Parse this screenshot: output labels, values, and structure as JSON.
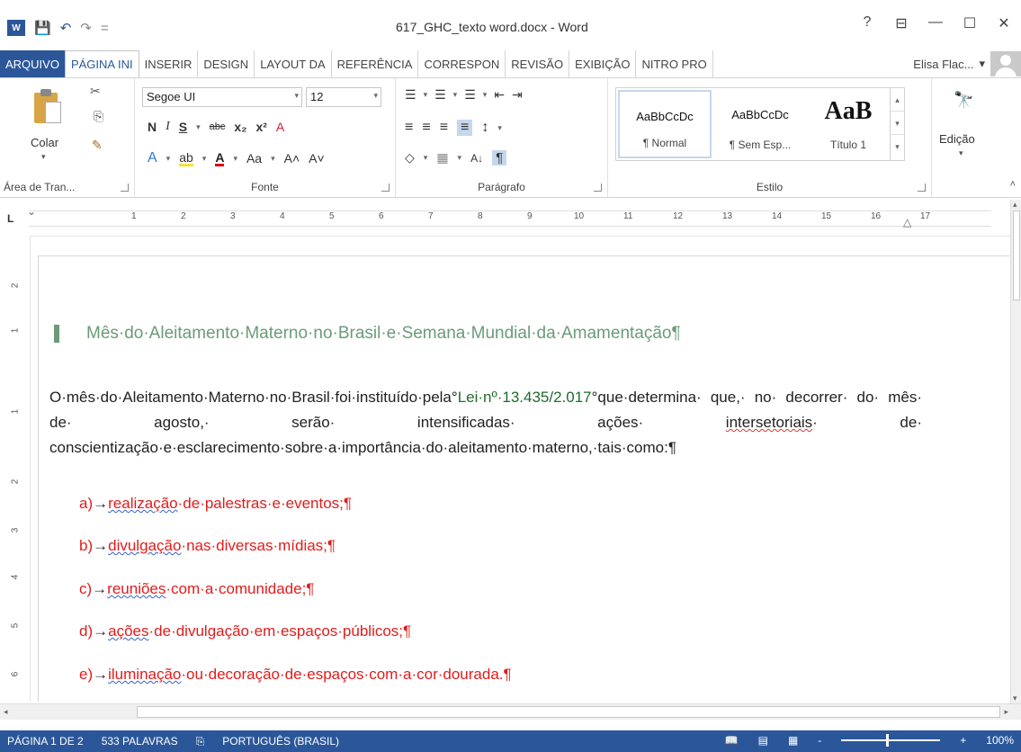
{
  "window": {
    "title": "617_GHC_texto word.docx - Word",
    "help": "?",
    "restore_ribbon": "⊟",
    "minimize": "—",
    "maximize": "☐",
    "close": "✕"
  },
  "qat": {
    "app_logo": "W",
    "save": "💾",
    "undo": "↶",
    "redo": "↷",
    "customize": "="
  },
  "tabs": [
    {
      "label": "ARQUIVO"
    },
    {
      "label": "PÁGINA INI"
    },
    {
      "label": "INSERIR"
    },
    {
      "label": "DESIGN"
    },
    {
      "label": "LAYOUT DA"
    },
    {
      "label": "REFERÊNCIA"
    },
    {
      "label": "CORRESPON"
    },
    {
      "label": "REVISÃO"
    },
    {
      "label": "EXIBIÇÃO"
    },
    {
      "label": "NITRO PRO"
    }
  ],
  "user": {
    "name": "Elisa Flac...",
    "dropdown": "▾"
  },
  "clipboard": {
    "paste_label": "Colar",
    "group_label": "Área de Tran...",
    "cut": "✂",
    "copy": "⎘",
    "format_painter": "✎"
  },
  "font": {
    "family": "Segoe UI",
    "size": "12",
    "bold": "N",
    "italic": "I",
    "underline": "S",
    "strike": "abc",
    "subscript": "x₂",
    "superscript": "x²",
    "clear": "A",
    "text_effects": "A",
    "highlight": "ab",
    "font_color": "A",
    "change_case": "Aa",
    "grow": "A˄",
    "shrink": "A˅",
    "group_label": "Fonte"
  },
  "paragraph": {
    "bullets": "☰",
    "numbering": "☰",
    "multilevel": "☰",
    "decrease_indent": "⇤",
    "increase_indent": "⇥",
    "align_left": "≡",
    "align_center": "≡",
    "align_right": "≡",
    "justify": "≡",
    "line_spacing": "↕",
    "shading": "◇",
    "borders": "▦",
    "sort": "A↓",
    "show_marks": "¶",
    "group_label": "Parágrafo"
  },
  "styles": {
    "items": [
      {
        "sample": "AaBbCcDc",
        "name": "¶ Normal"
      },
      {
        "sample": "AaBbCcDc",
        "name": "¶ Sem Esp..."
      },
      {
        "sample": "AaB",
        "name": "Título 1"
      }
    ],
    "group_label": "Estilo"
  },
  "editing": {
    "label": "Edição",
    "icon": "🔭"
  },
  "ruler": {
    "tab_selector": "L",
    "numbers": [
      "1",
      "2",
      "3",
      "4",
      "5",
      "6",
      "7",
      "8",
      "9",
      "10",
      "11",
      "12",
      "13",
      "14",
      "15",
      "16",
      "17"
    ]
  },
  "vruler": {
    "numbers": [
      "2",
      "1",
      "1",
      "2",
      "3",
      "4",
      "5",
      "6"
    ]
  },
  "document": {
    "heading": "Mês·do·Aleitamento·Materno·no·Brasil·e·Semana·Mundial·da·Amamentação¶",
    "para": {
      "part1": "O·mês·do·Aleitamento·Materno·no·Brasil·foi·instituído·pela°",
      "law": "Lei·nº·13.435/2.017",
      "part2": "°que·determina· que,· no· decorrer· do· mês· de· agosto,· serão· intensificadas· ações· ",
      "squig": "intersetoriais",
      "part3": "· de· conscientização·e·esclarecimento·sobre·a·importância·do·aleitamento·materno,·tais·como:",
      "mark": "¶"
    },
    "items": [
      {
        "prefix": "a)",
        "arrow": "→",
        "underlined": "realização",
        "rest": "·de·palestras·e·eventos;",
        "mark": "¶"
      },
      {
        "prefix": "b)",
        "arrow": "→",
        "underlined": "divulgação",
        "rest": "·nas·diversas·mídias;",
        "mark": "¶"
      },
      {
        "prefix": "c)",
        "arrow": "→",
        "underlined": "reuniões",
        "rest": "·com·a·comunidade;",
        "mark": "¶"
      },
      {
        "prefix": "d)",
        "arrow": "→",
        "underlined": "ações",
        "rest": "·de·divulgação·em·espaços·públicos;",
        "mark": "¶"
      },
      {
        "prefix": "e)",
        "arrow": "→",
        "underlined": "iluminação",
        "rest": "·ou·decoração·de·espaços·com·a·cor·dourada.",
        "mark": "¶"
      }
    ]
  },
  "status": {
    "page": "PÁGINA 1 DE 2",
    "words": "533 PALAVRAS",
    "proof_icon": "⎘",
    "language": "PORTUGUÊS (BRASIL)",
    "read_mode": "📖",
    "print_layout": "▤",
    "web_layout": "▦",
    "zoom_out": "-",
    "zoom_in": "+",
    "zoom": "100%",
    "zoom_level": 1.0
  },
  "colors": {
    "word_blue": "#2b579a",
    "heading_green": "#6b9b78",
    "list_red": "#e21c1c",
    "law_green": "#1f6b2a"
  }
}
